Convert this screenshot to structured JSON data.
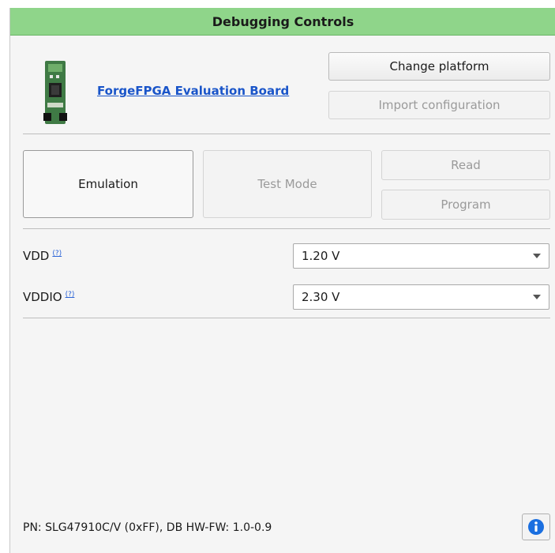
{
  "header": {
    "title": "Debugging Controls"
  },
  "board": {
    "name": "ForgeFPGA Evaluation Board"
  },
  "platform": {
    "change_label": "Change platform",
    "import_label": "Import configuration"
  },
  "modes": {
    "emulation_label": "Emulation",
    "test_mode_label": "Test Mode",
    "read_label": "Read",
    "program_label": "Program"
  },
  "power": {
    "vdd": {
      "label": "VDD",
      "value": "1.20 V"
    },
    "vddio": {
      "label": "VDDIO",
      "value": "2.30 V"
    },
    "help_marker": "(?)"
  },
  "status": {
    "text": "PN: SLG47910C/V (0xFF), DB HW-FW: 1.0-0.9"
  },
  "colors": {
    "header_bg": "#8fd58a",
    "link": "#1a55c9",
    "info_icon": "#1a6fe0"
  }
}
